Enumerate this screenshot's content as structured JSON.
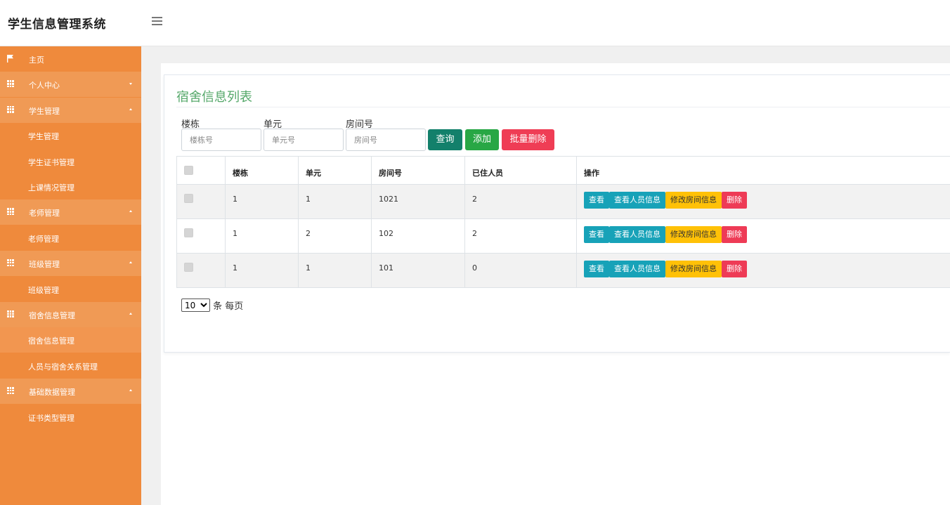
{
  "app": {
    "title": "学生信息管理系统"
  },
  "sidebar": {
    "items": [
      {
        "label": "主页",
        "type": "top",
        "icon": "flag-icon"
      },
      {
        "label": "个人中心",
        "type": "group",
        "icon": "grid-icon",
        "expanded": false
      },
      {
        "label": "学生管理",
        "type": "group",
        "icon": "grid-icon",
        "expanded": true
      },
      {
        "label": "学生管理",
        "type": "sub"
      },
      {
        "label": "学生证书管理",
        "type": "sub"
      },
      {
        "label": "上课情况管理",
        "type": "sub"
      },
      {
        "label": "老师管理",
        "type": "group",
        "icon": "grid-icon",
        "expanded": true
      },
      {
        "label": "老师管理",
        "type": "sub"
      },
      {
        "label": "班级管理",
        "type": "group",
        "icon": "grid-icon",
        "expanded": true
      },
      {
        "label": "班级管理",
        "type": "sub"
      },
      {
        "label": "宿舍信息管理",
        "type": "group",
        "icon": "grid-icon",
        "expanded": true
      },
      {
        "label": "宿舍信息管理",
        "type": "sub",
        "active": true
      },
      {
        "label": "人员与宿舍关系管理",
        "type": "sub"
      },
      {
        "label": "基础数据管理",
        "type": "group",
        "icon": "grid-icon",
        "expanded": true
      },
      {
        "label": "证书类型管理",
        "type": "sub"
      }
    ]
  },
  "main": {
    "title": "宿舍信息列表",
    "filters": {
      "building_label": "楼栋",
      "building_placeholder": "楼栋号",
      "unit_label": "单元",
      "unit_placeholder": "单元号",
      "room_label": "房间号",
      "room_placeholder": "房间号"
    },
    "buttons": {
      "query": "查询",
      "add": "添加",
      "batch_delete": "批量删除"
    },
    "table": {
      "headers": [
        "楼栋",
        "单元",
        "房间号",
        "已住人员",
        "操作"
      ],
      "rows": [
        {
          "building": "1",
          "unit": "1",
          "room": "1021",
          "residents": "2"
        },
        {
          "building": "1",
          "unit": "2",
          "room": "102",
          "residents": "2"
        },
        {
          "building": "1",
          "unit": "1",
          "room": "101",
          "residents": "0"
        }
      ],
      "actions": {
        "view": "查看",
        "view_people": "查看人员信息",
        "edit_room": "修改房间信息",
        "delete": "删除"
      }
    },
    "pagination": {
      "page_size": "10",
      "suffix": "条 每页"
    }
  },
  "colors": {
    "sidebar": "#ef8a3c",
    "title_green": "#55a86a",
    "query": "#13806b",
    "add": "#28a745",
    "danger": "#ee3b56",
    "info": "#17a2b8",
    "warning": "#ffc107"
  }
}
